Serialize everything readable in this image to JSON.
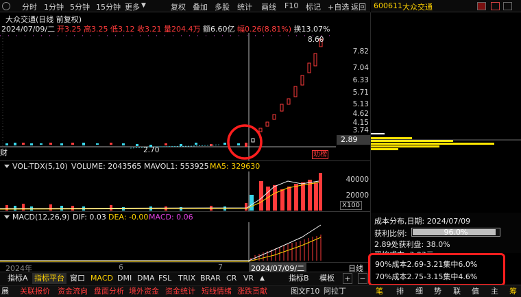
{
  "toolbar": {
    "periods": [
      "分时",
      "1分钟",
      "5分钟",
      "15分钟",
      "更多"
    ],
    "menu": [
      "复权",
      "叠加",
      "多股",
      "统计",
      "画线",
      "F10",
      "标记",
      "+自选",
      "返回"
    ]
  },
  "header": {
    "title": "大众交通(日线 前复权)",
    "date": "2024/07/09/二",
    "open_label": "开",
    "open": "3.25",
    "high_label": "高",
    "high": "3.25",
    "low_label": "低",
    "low": "3.12",
    "close_label": "收",
    "close": "3.21",
    "vol_label": "量",
    "vol": "204.4万",
    "amt_label": "额",
    "amt": "6.60亿",
    "chg_label": "幅",
    "chg": "0.26(8.81%)",
    "turn_label": "换",
    "turn": "13.07%"
  },
  "price_axis": [
    "7.82",
    "7.04",
    "6.33",
    "5.71",
    "5.13",
    "4.62",
    "4.15",
    "3.74",
    "2.89"
  ],
  "price_annotations": {
    "peak": "8.60",
    "low": "2.70",
    "tag": "劝榜"
  },
  "volume_header": {
    "name": "VOL-TDX(5,10)",
    "volume": "VOLUME: 2043565",
    "mavol1": "MAVOL1: 553925",
    "ma5": "MA5: 329630"
  },
  "volume_axis": [
    "40000",
    "20000",
    "X100"
  ],
  "macd_header": {
    "name": "MACD(12,26,9)",
    "dif": "DIF: 0.03",
    "dea": "DEA: -0.00",
    "macd": "MACD: 0.06"
  },
  "date_axis": {
    "left": "2024年",
    "m6": "6",
    "m7": "7",
    "cursor": "2024/07/09/二",
    "cycle": "日线"
  },
  "indicator_tabs": [
    "指标A",
    "指标平台",
    "窗口",
    "MACD",
    "DMI",
    "DMA",
    "FSL",
    "TRIX",
    "BRAR",
    "CR",
    "VR",
    "指标B",
    "模板"
  ],
  "status_tabs": [
    "展",
    "关联报价",
    "资金流向",
    "盘面分析",
    "境外资金",
    "资金统计",
    "短线情绪",
    "涨跌贡献",
    "图文F10",
    "阿拉丁",
    "笔",
    "排",
    "细",
    "势",
    "联",
    "值",
    "主",
    "筹"
  ],
  "right_header": {
    "code": "600611",
    "name": "大众交通"
  },
  "cost_panel": {
    "title": "成本分布,日期:  2024/07/09",
    "profit_label": "获利比例:",
    "profit_pct": "96.0%",
    "profit_value": 0.96,
    "profit_line": "2.89处获利盘:  38.0%",
    "avg_line": "平均成本:  3.03元",
    "c90": "90%成本2.69-3.21集中6.0%",
    "c70": "70%成本2.75-3.15集中4.6%"
  },
  "left_tag": "财",
  "colors": {
    "up": "#ff3b3b",
    "down": "#39d6ea",
    "highlight": "#ff1e1e",
    "chip": "#ffe600"
  }
}
